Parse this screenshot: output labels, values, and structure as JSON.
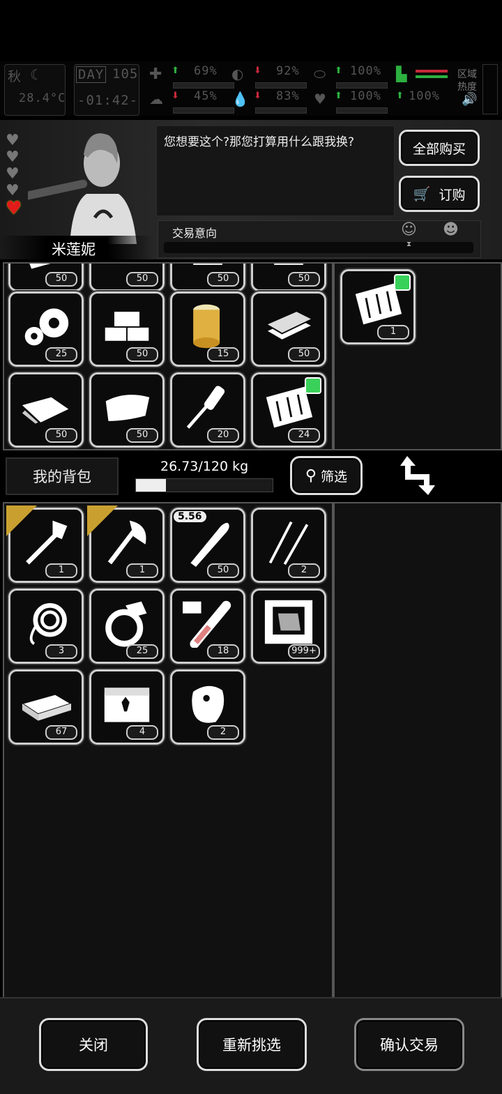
{
  "status": {
    "season": "秋",
    "temperature": "28.4°C",
    "day_label": "DAY",
    "day": "105",
    "time": "-01:42-",
    "stats": [
      "69%",
      "45%",
      "92%",
      "83%",
      "100%",
      "100%",
      "100%"
    ],
    "region_heat": "区域\n热度"
  },
  "npc": {
    "name": "米莲妮",
    "dialog": "您想要这个?那您打算用什么跟我换?",
    "trade_intent_label": "交易意向",
    "hearts_total": 5,
    "hearts_filled": 1
  },
  "buttons": {
    "buy_all": "全部购买",
    "order": "订购",
    "filter": "筛选",
    "close": "关闭",
    "reselect": "重新挑选",
    "confirm": "确认交易"
  },
  "backpack": {
    "title": "我的背包",
    "weight": "26.73/120 kg",
    "fill_fraction": 0.22
  },
  "merchant_items": [
    {
      "name": "cloth-scrap",
      "qty": "50"
    },
    {
      "name": "rope-pieces",
      "qty": "50"
    },
    {
      "name": "item",
      "qty": "50"
    },
    {
      "name": "item",
      "qty": "50"
    },
    {
      "name": "gears",
      "qty": "25"
    },
    {
      "name": "bricks",
      "qty": "50"
    },
    {
      "name": "tape-roll",
      "qty": "15"
    },
    {
      "name": "planks",
      "qty": "50"
    },
    {
      "name": "cloth",
      "qty": "50"
    },
    {
      "name": "fabric",
      "qty": "50"
    },
    {
      "name": "screwdriver",
      "qty": "20"
    },
    {
      "name": "sandpaper",
      "qty": "24"
    }
  ],
  "trade_offer": [
    {
      "name": "sandpaper",
      "qty": "1"
    }
  ],
  "player_items": [
    {
      "name": "shovel",
      "qty": "1"
    },
    {
      "name": "axe",
      "qty": "1"
    },
    {
      "name": "bullet",
      "qty": "50",
      "tag": "5.56"
    },
    {
      "name": "picks",
      "qty": "2"
    },
    {
      "name": "rope",
      "qty": "3"
    },
    {
      "name": "ring",
      "qty": "25"
    },
    {
      "name": "test-tube",
      "qty": "18"
    },
    {
      "name": "zombie-card",
      "qty": "999+"
    },
    {
      "name": "cash",
      "qty": "67"
    },
    {
      "name": "chest",
      "qty": "4"
    },
    {
      "name": "meat",
      "qty": "2"
    }
  ]
}
